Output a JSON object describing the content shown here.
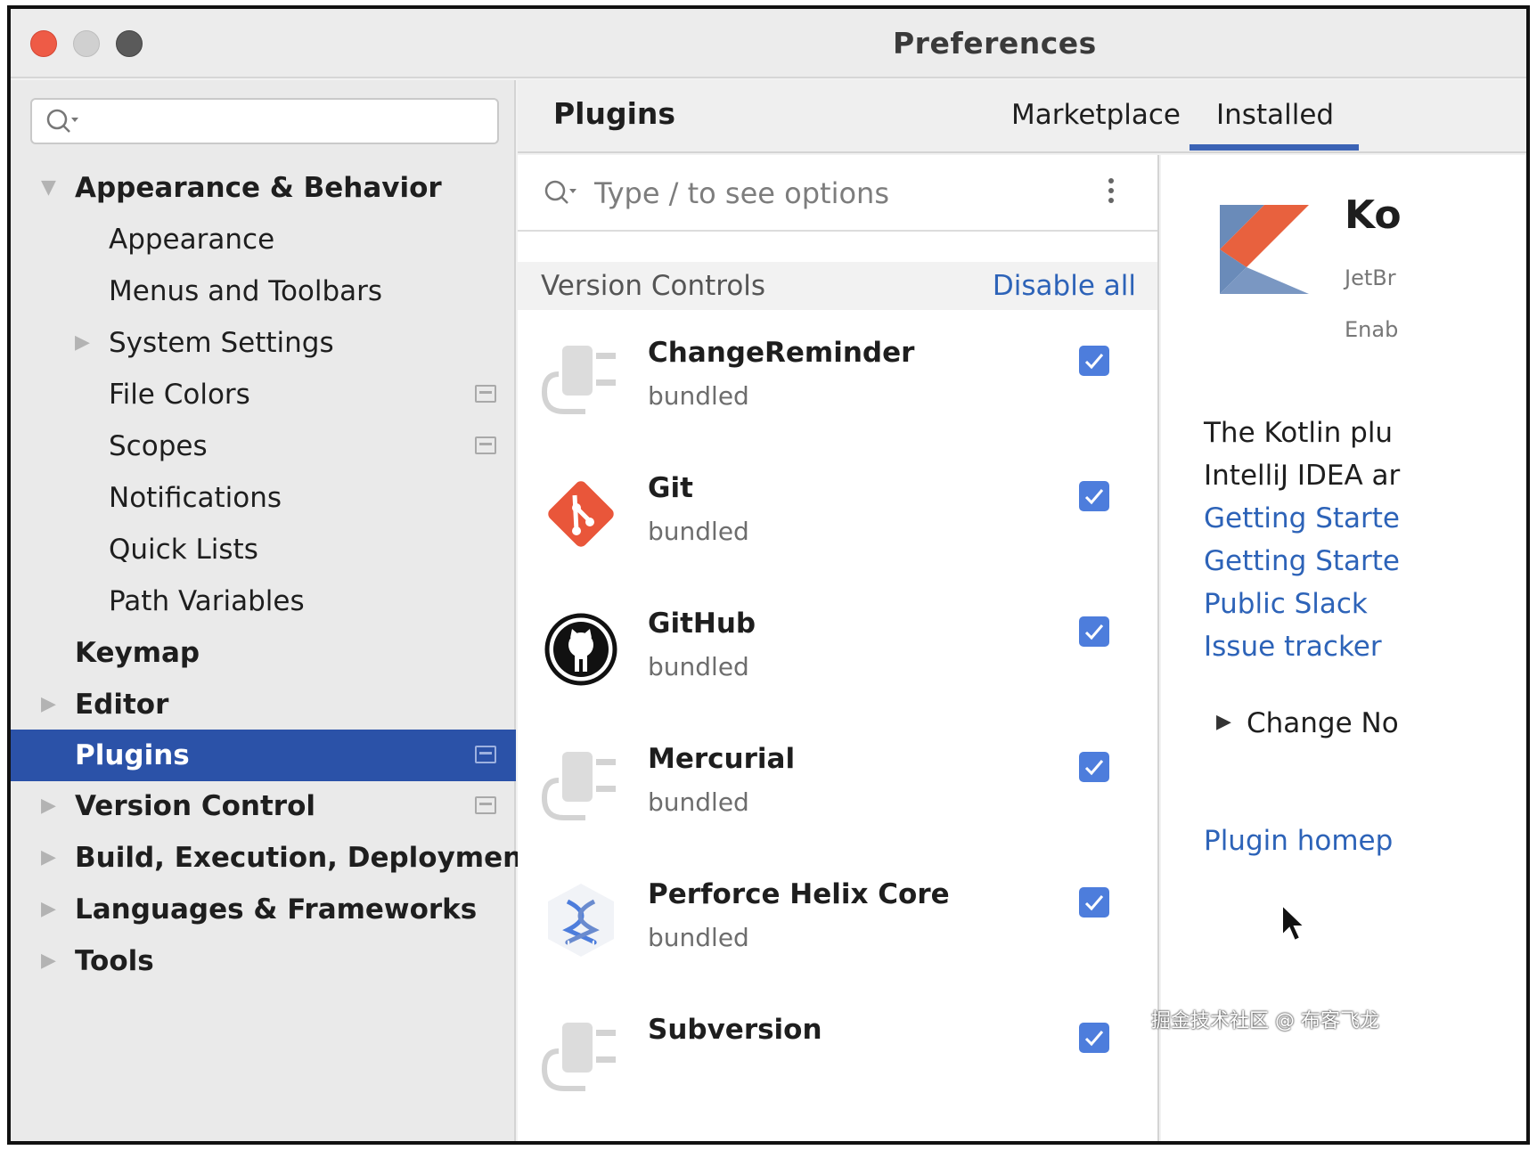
{
  "window": {
    "title": "Preferences"
  },
  "sidebar": {
    "search": {
      "value": "",
      "placeholder": ""
    },
    "items": [
      {
        "label": "Appearance & Behavior",
        "level": 0,
        "expanded": true,
        "bold": true
      },
      {
        "label": "Appearance",
        "level": 1
      },
      {
        "label": "Menus and Toolbars",
        "level": 1
      },
      {
        "label": "System Settings",
        "level": 1,
        "collapsed": true
      },
      {
        "label": "File Colors",
        "level": 1,
        "marker": true
      },
      {
        "label": "Scopes",
        "level": 1,
        "marker": true
      },
      {
        "label": "Notifications",
        "level": 1
      },
      {
        "label": "Quick Lists",
        "level": 1
      },
      {
        "label": "Path Variables",
        "level": 1
      },
      {
        "label": "Keymap",
        "level": 0,
        "bold": true
      },
      {
        "label": "Editor",
        "level": 0,
        "bold": true,
        "collapsed": true
      },
      {
        "label": "Plugins",
        "level": 0,
        "bold": true,
        "selected": true,
        "marker": true
      },
      {
        "label": "Version Control",
        "level": 0,
        "bold": true,
        "collapsed": true,
        "marker": true
      },
      {
        "label": "Build, Execution, Deployment",
        "level": 0,
        "bold": true,
        "collapsed": true
      },
      {
        "label": "Languages & Frameworks",
        "level": 0,
        "bold": true,
        "collapsed": true
      },
      {
        "label": "Tools",
        "level": 0,
        "bold": true,
        "collapsed": true
      }
    ]
  },
  "main": {
    "title": "Plugins",
    "tabs": [
      {
        "label": "Marketplace",
        "active": false
      },
      {
        "label": "Installed",
        "active": true
      }
    ]
  },
  "list": {
    "search_placeholder": "Type / to see options",
    "group": {
      "name": "Version Controls",
      "action": "Disable all"
    },
    "plugins": [
      {
        "name": "ChangeReminder",
        "sub": "bundled",
        "icon": "plug-icon",
        "enabled": true
      },
      {
        "name": "Git",
        "sub": "bundled",
        "icon": "git-icon",
        "enabled": true
      },
      {
        "name": "GitHub",
        "sub": "bundled",
        "icon": "github-icon",
        "enabled": true
      },
      {
        "name": "Mercurial",
        "sub": "bundled",
        "icon": "plug-icon",
        "enabled": true
      },
      {
        "name": "Perforce Helix Core",
        "sub": "bundled",
        "icon": "perforce-icon",
        "enabled": true
      },
      {
        "name": "Subversion",
        "sub": "",
        "icon": "plug-icon",
        "enabled": true
      }
    ]
  },
  "details": {
    "name": "Ko",
    "vendor": "JetBr",
    "status": "Enab",
    "desc_lines": [
      "The Kotlin plu",
      "IntelliJ IDEA ar"
    ],
    "links": [
      "Getting Starte",
      "Getting Starte",
      "Public Slack",
      "Issue tracker"
    ],
    "change_notes": "Change No",
    "homepage": "Plugin homep"
  },
  "watermark": "掘金技术社区 @ 布客飞龙",
  "colors": {
    "accent": "#2b52a8",
    "link": "#2d63b8",
    "checkbox": "#4d7ddc",
    "git": "#e9563a"
  }
}
